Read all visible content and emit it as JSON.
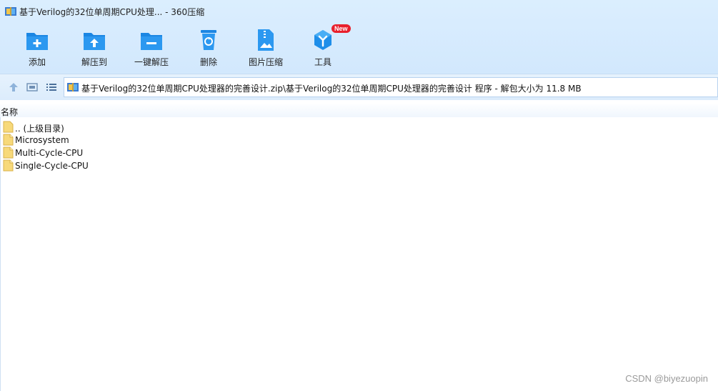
{
  "window": {
    "title": "基于Verilog的32位单周期CPU处理... - 360压缩"
  },
  "toolbar": {
    "buttons": [
      {
        "label": "添加",
        "icon": "add-folder-icon"
      },
      {
        "label": "解压到",
        "icon": "extract-to-icon"
      },
      {
        "label": "一键解压",
        "icon": "one-click-extract-icon"
      },
      {
        "label": "删除",
        "icon": "recycle-bin-icon"
      },
      {
        "label": "图片压缩",
        "icon": "image-compress-icon"
      },
      {
        "label": "工具",
        "icon": "tools-icon",
        "badge": "New"
      }
    ]
  },
  "nav": {
    "path": "基于Verilog的32位单周期CPU处理器的完善设计.zip\\基于Verilog的32位单周期CPU处理器的完善设计 程序 - 解包大小为 11.8 MB"
  },
  "list": {
    "column_name": "名称",
    "items": [
      {
        "name": ".. (上级目录)",
        "icon": "folder-up-icon"
      },
      {
        "name": "Microsystem",
        "icon": "file-icon"
      },
      {
        "name": "Multi-Cycle-CPU",
        "icon": "file-icon"
      },
      {
        "name": "Single-Cycle-CPU",
        "icon": "file-icon"
      }
    ]
  },
  "watermark": "CSDN @biyezuopin",
  "colors": {
    "toolbar_bg": "#d2e8fd",
    "icon_blue": "#1e8ee9",
    "badge_red": "#e8202c"
  }
}
